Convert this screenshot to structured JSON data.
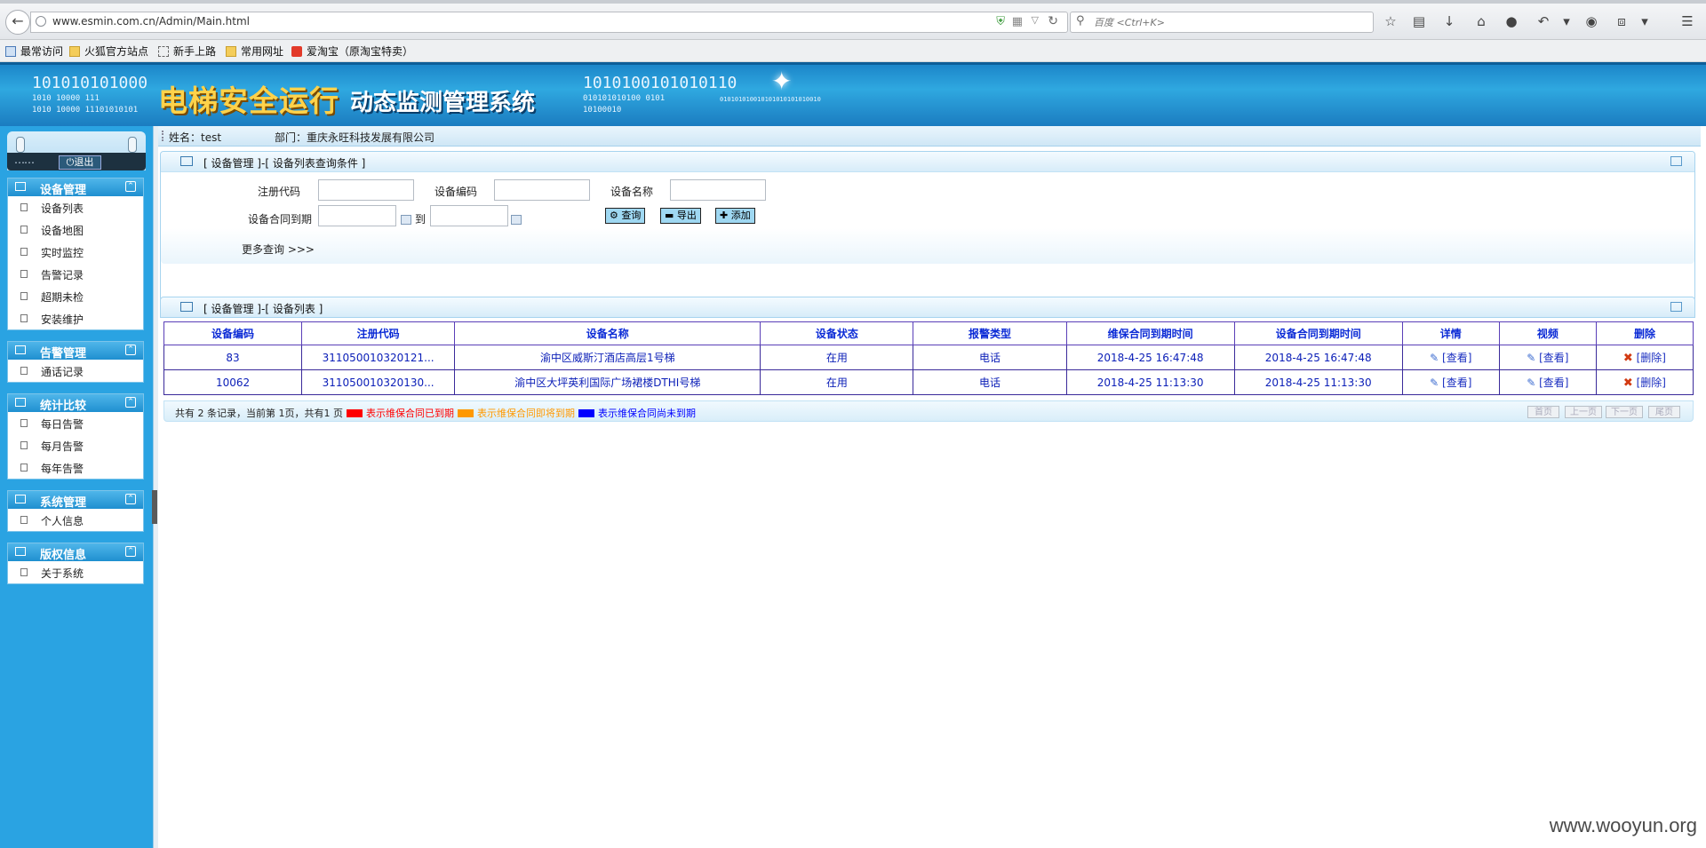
{
  "browser": {
    "url": "www.esmin.com.cn/Admin/Main.html",
    "search_placeholder": "百度 <Ctrl+K>",
    "bookmarks": [
      "最常访问",
      "火狐官方站点",
      "新手上路",
      "常用网址",
      "爱淘宝（原淘宝特卖）"
    ]
  },
  "banner": {
    "title_part1": "电梯安全运行",
    "title_part2": "动态监测管理系统",
    "binary": [
      "101010101000",
      "1010 10000 111",
      "1010 10000 11101010101",
      "1010100101010110",
      "010101010100 0101",
      "10100010",
      "010101010010101010101010010"
    ]
  },
  "sidebar": {
    "logout_label": "退出",
    "groups": [
      {
        "title": "设备管理",
        "items": [
          "设备列表",
          "设备地图",
          "实时监控",
          "告警记录",
          "超期未检",
          "安装维护"
        ]
      },
      {
        "title": "告警管理",
        "items": [
          "通话记录"
        ]
      },
      {
        "title": "统计比较",
        "items": [
          "每日告警",
          "每月告警",
          "每年告警"
        ]
      },
      {
        "title": "系统管理",
        "items": [
          "个人信息"
        ]
      },
      {
        "title": "版权信息",
        "items": [
          "关于系统"
        ]
      }
    ]
  },
  "userbar": {
    "name": "姓名：test",
    "dept": "部门：重庆永旺科技发展有限公司"
  },
  "query_panel": {
    "title": "[ 设备管理 ]-[ 设备列表查询条件 ]",
    "labels": {
      "reg_code": "注册代码",
      "device_code": "设备编码",
      "device_name": "设备名称",
      "contract_expire": "设备合同到期",
      "to": "到"
    },
    "buttons": {
      "query": "查询",
      "export": "导出",
      "add": "添加"
    },
    "more": "更多查询 >>>"
  },
  "list_panel": {
    "title": "[ 设备管理 ]-[ 设备列表 ]"
  },
  "table": {
    "headers": [
      "设备编码",
      "注册代码",
      "设备名称",
      "设备状态",
      "报警类型",
      "维保合同到期时间",
      "设备合同到期时间",
      "详情",
      "视频",
      "删除"
    ],
    "rows": [
      [
        "83",
        "311050010320121...",
        "渝中区威斯汀酒店高层1号梯",
        "在用",
        "电话",
        "2018-4-25 16:47:48",
        "2018-4-25 16:47:48",
        "[查看]",
        "[查看]",
        "[删除]"
      ],
      [
        "10062",
        "311050010320130...",
        "渝中区大坪英利国际广场裙楼DTHI号梯",
        "在用",
        "电话",
        "2018-4-25 11:13:30",
        "2018-4-25 11:13:30",
        "[查看]",
        "[查看]",
        "[删除]"
      ]
    ]
  },
  "footer": {
    "summary": "共有 2 条记录，当前第 1页，共有1 页",
    "legend": [
      {
        "color": "#ff0000",
        "text": "表示维保合同已到期"
      },
      {
        "color": "#ff9900",
        "text": "表示维保合同即将到期"
      },
      {
        "color": "#0000ff",
        "text": "表示维保合同尚未到期"
      }
    ],
    "pager": [
      "首页",
      "上一页",
      "下一页",
      "尾页"
    ]
  },
  "watermark": "www.wooyun.org"
}
